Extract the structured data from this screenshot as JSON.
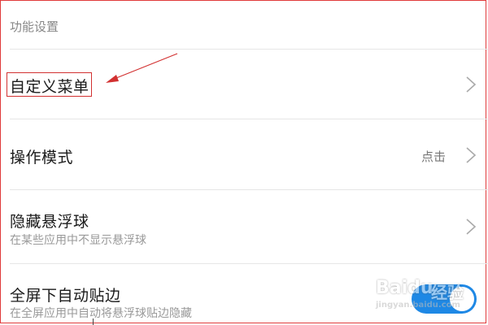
{
  "section": {
    "header": "功能设置"
  },
  "rows": [
    {
      "title": "自定义菜单",
      "has_chevron": true
    },
    {
      "title": "操作模式",
      "value": "点击",
      "has_chevron": true
    },
    {
      "title": "隐藏悬浮球",
      "subtitle": "在某些应用中不显示悬浮球",
      "has_chevron": true
    },
    {
      "title": "全屏下自动贴边",
      "subtitle": "在全屏应用中自动将悬浮球贴边隐藏",
      "toggle_on": true
    }
  ],
  "annotation": {
    "color": "#d23131",
    "target": "自定义菜单"
  },
  "watermark": {
    "brand": "Baidu",
    "suffix": "经验",
    "url": "jingyan.baidu.com"
  },
  "colors": {
    "accent": "#1e88e5",
    "divider": "#e6e6e6",
    "annotation": "#d23131"
  },
  "icons": {
    "row_arrow": "chevron-right-icon"
  }
}
